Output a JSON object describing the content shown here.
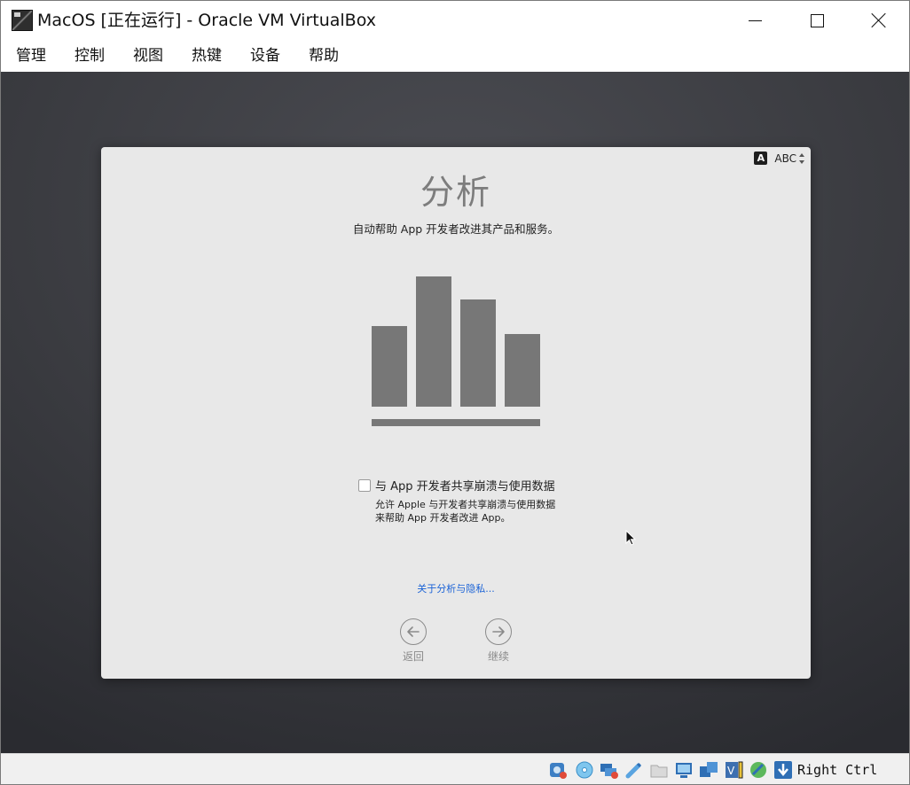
{
  "window": {
    "title": "MacOS [正在运行] - Oracle VM VirtualBox"
  },
  "menu": {
    "items": [
      {
        "label": "管理"
      },
      {
        "label": "控制"
      },
      {
        "label": "视图"
      },
      {
        "label": "热键"
      },
      {
        "label": "设备"
      },
      {
        "label": "帮助"
      }
    ]
  },
  "setup": {
    "input_source": {
      "badge": "A",
      "label": "ABC"
    },
    "title": "分析",
    "subtitle": "自动帮助 App 开发者改进其产品和服务。",
    "share_checkbox": {
      "label": "与 App 开发者共享崩溃与使用数据",
      "checked": false,
      "description_line1": "允许 Apple 与开发者共享崩溃与使用数据",
      "description_line2": "来帮助 App 开发者改进 App。"
    },
    "about_link": "关于分析与隐私...",
    "back_label": "返回",
    "continue_label": "继续"
  },
  "illustration": {
    "bar_levels": [
      0.62,
      1.0,
      0.82,
      0.56
    ],
    "color": "#777777"
  },
  "statusbar": {
    "host_key": "Right Ctrl",
    "icons": [
      "hard-disk-icon",
      "optical-disk-icon",
      "network-icon",
      "usb-icon",
      "shared-folders-icon",
      "display-icon",
      "virtual-network-icon",
      "recording-icon",
      "guest-additions-icon",
      "keyboard-capture-icon"
    ]
  },
  "colors": {
    "accent_link": "#1a62d6",
    "panel_bg": "#e8e8e8",
    "vm_bg": "#3a3b40"
  }
}
